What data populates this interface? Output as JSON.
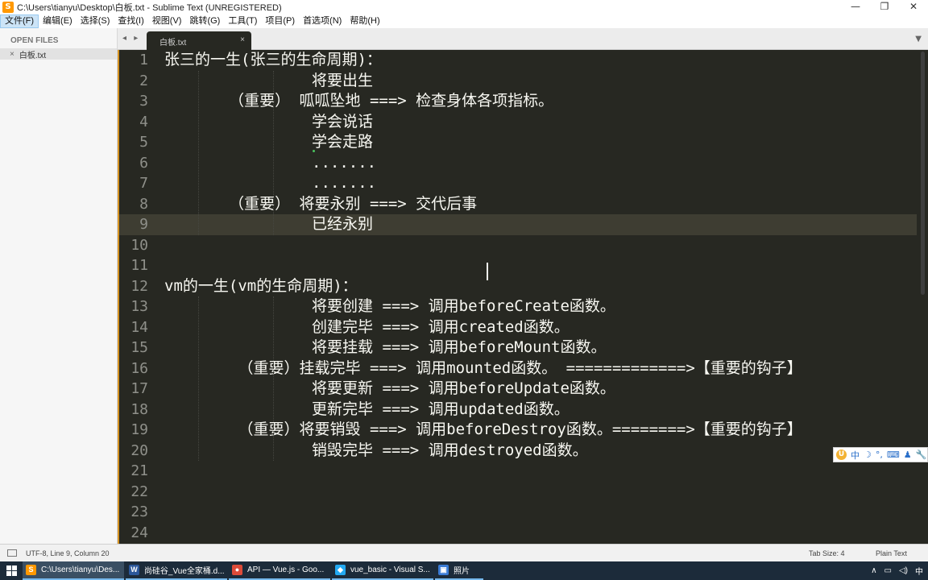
{
  "window": {
    "title": "C:\\Users\\tianyu\\Desktop\\白板.txt - Sublime Text (UNREGISTERED)",
    "minimize": "—",
    "maximize": "❐",
    "close": "✕"
  },
  "menu": [
    "文件(F)",
    "编辑(E)",
    "选择(S)",
    "查找(I)",
    "视图(V)",
    "跳转(G)",
    "工具(T)",
    "项目(P)",
    "首选项(N)",
    "帮助(H)"
  ],
  "sidebar": {
    "header": "OPEN FILES",
    "files": [
      {
        "name": "白板.txt",
        "close": "×"
      }
    ]
  },
  "tabs": {
    "nav": "◂ ▸",
    "items": [
      {
        "label": "白板.txt",
        "close": "×"
      }
    ],
    "dropdown": "▼"
  },
  "editor": {
    "current_line": 9,
    "lines": [
      "张三的一生(张三的生命周期)：",
      "                将要出生",
      "       （重要） 呱呱坠地 ===> 检查身体各项指标。",
      "                学会说话",
      "                学会走路",
      "                .......",
      "                .......",
      "       （重要） 将要永别 ===> 交代后事",
      "                已经永别",
      "",
      "",
      "vm的一生(vm的生命周期)：",
      "                将要创建 ===> 调用beforeCreate函数。",
      "                创建完毕 ===> 调用created函数。",
      "                将要挂载 ===> 调用beforeMount函数。",
      "        （重要）挂载完毕 ===> 调用mounted函数。 =============>【重要的钩子】",
      "                将要更新 ===> 调用beforeUpdate函数。",
      "                更新完毕 ===> 调用updated函数。",
      "        （重要）将要销毁 ===> 调用beforeDestroy函数。========>【重要的钩子】",
      "                销毁完毕 ===> 调用destroyed函数。",
      "",
      "",
      "",
      ""
    ]
  },
  "ime": {
    "logo": "U",
    "mode": "中",
    "moon": "☽",
    "punct": "°,",
    "keyboard": "⌨",
    "user": "♟",
    "settings": "🔧"
  },
  "status": {
    "info": "UTF-8, Line 9, Column 20",
    "tab_size": "Tab Size: 4",
    "syntax": "Plain Text"
  },
  "taskbar": {
    "items": [
      {
        "label": "C:\\Users\\tianyu\\Des...",
        "icon": "S",
        "color": "#ff9800",
        "active": true
      },
      {
        "label": "尚硅谷_Vue全家桶.d...",
        "icon": "W",
        "color": "#2b579a",
        "active": false
      },
      {
        "label": "API — Vue.js - Goo...",
        "icon": "●",
        "color": "#dd4b39",
        "active": false
      },
      {
        "label": "vue_basic - Visual S...",
        "icon": "◆",
        "color": "#23a9f2",
        "active": false
      },
      {
        "label": "照片",
        "icon": "▣",
        "color": "#3a7bd5",
        "active": false
      }
    ],
    "tray": {
      "chevron": "∧",
      "battery": "▭",
      "volume": "◁)",
      "ime": "中"
    }
  }
}
